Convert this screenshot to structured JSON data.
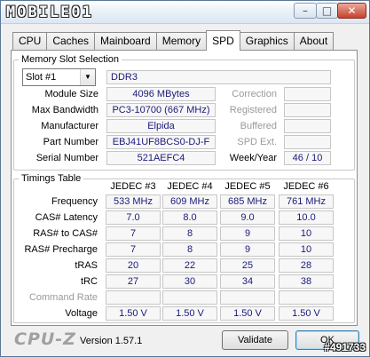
{
  "window": {
    "logo_text": "MOBILE01",
    "minimize": "–",
    "maximize": "□",
    "close": "✕",
    "colors": {
      "accent": "#1a1a7a",
      "frame": "#b9d1ea"
    }
  },
  "tabs": [
    "CPU",
    "Caches",
    "Mainboard",
    "Memory",
    "SPD",
    "Graphics",
    "About"
  ],
  "active_tab": "SPD",
  "slot_group": {
    "title": "Memory Slot Selection",
    "slot_value": "Slot #1",
    "type_value": "DDR3",
    "rows": [
      {
        "label": "Module Size",
        "value": "4096 MBytes",
        "side_label": "Correction",
        "side_value": ""
      },
      {
        "label": "Max Bandwidth",
        "value": "PC3-10700 (667 MHz)",
        "side_label": "Registered",
        "side_value": ""
      },
      {
        "label": "Manufacturer",
        "value": "Elpida",
        "side_label": "Buffered",
        "side_value": ""
      },
      {
        "label": "Part Number",
        "value": "EBJ41UF8BCS0-DJ-F",
        "side_label": "SPD Ext.",
        "side_value": ""
      },
      {
        "label": "Serial Number",
        "value": "521AEFC4",
        "side_label": "Week/Year",
        "side_value": "46 / 10"
      }
    ]
  },
  "timings": {
    "title": "Timings Table",
    "columns": [
      "JEDEC #3",
      "JEDEC #4",
      "JEDEC #5",
      "JEDEC #6"
    ],
    "rows": [
      {
        "label": "Frequency",
        "values": [
          "533 MHz",
          "609 MHz",
          "685 MHz",
          "761 MHz"
        ],
        "dim": false
      },
      {
        "label": "CAS# Latency",
        "values": [
          "7.0",
          "8.0",
          "9.0",
          "10.0"
        ],
        "dim": false
      },
      {
        "label": "RAS# to CAS#",
        "values": [
          "7",
          "8",
          "9",
          "10"
        ],
        "dim": false
      },
      {
        "label": "RAS# Precharge",
        "values": [
          "7",
          "8",
          "9",
          "10"
        ],
        "dim": false
      },
      {
        "label": "tRAS",
        "values": [
          "20",
          "22",
          "25",
          "28"
        ],
        "dim": false
      },
      {
        "label": "tRC",
        "values": [
          "27",
          "30",
          "34",
          "38"
        ],
        "dim": false
      },
      {
        "label": "Command Rate",
        "values": [
          "",
          "",
          "",
          ""
        ],
        "dim": true
      },
      {
        "label": "Voltage",
        "values": [
          "1.50 V",
          "1.50 V",
          "1.50 V",
          "1.50 V"
        ],
        "dim": false
      }
    ]
  },
  "footer": {
    "brand": "CPU-Z",
    "version": "Version 1.57.1",
    "validate_label": "Validate",
    "ok_label": "OK"
  },
  "watermark": "#491733"
}
